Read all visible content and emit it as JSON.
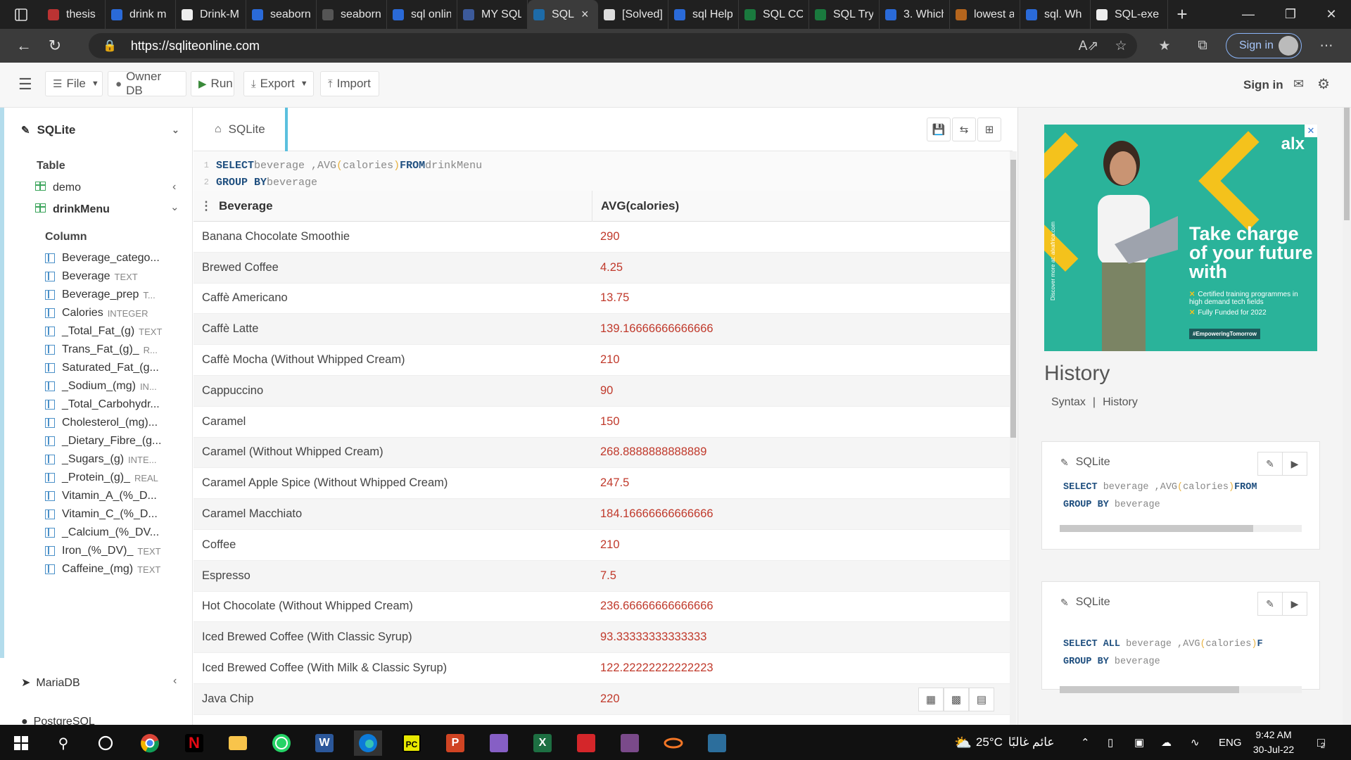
{
  "browser": {
    "tabs": [
      {
        "title": "thesis g",
        "color": "#b33"
      },
      {
        "title": "drink m",
        "color": "#2a6ad8"
      },
      {
        "title": "Drink-M",
        "color": "#eee"
      },
      {
        "title": "seaborn",
        "color": "#2a6ad8"
      },
      {
        "title": "seaborn",
        "color": "#555"
      },
      {
        "title": "sql onlin",
        "color": "#2a6ad8"
      },
      {
        "title": "MY SQL",
        "color": "#3c5a9a"
      },
      {
        "title": "SQL",
        "color": "#1d6ba8",
        "active": true
      },
      {
        "title": "[Solved]",
        "color": "#ddd"
      },
      {
        "title": "sql Help",
        "color": "#2a6ad8"
      },
      {
        "title": "SQL CO",
        "color": "#1a7a3e"
      },
      {
        "title": "SQL Try",
        "color": "#1a7a3e"
      },
      {
        "title": "3. Which",
        "color": "#2a6ad8"
      },
      {
        "title": "lowest a",
        "color": "#b5651d"
      },
      {
        "title": "sql. Wh",
        "color": "#2a6ad8"
      },
      {
        "title": "SQL-exe",
        "color": "#eee"
      }
    ],
    "url": "https://sqliteonline.com",
    "signin": "Sign in"
  },
  "toolbar": {
    "file": "File",
    "owner_db": "Owner DB",
    "run": "Run",
    "export": "Export",
    "import": "Import",
    "signin": "Sign in"
  },
  "sidebar": {
    "db_name": "SQLite",
    "table_heading": "Table",
    "tables": [
      "demo",
      "drinkMenu"
    ],
    "column_heading": "Column",
    "columns": [
      {
        "name": "Beverage_catego...",
        "type": ""
      },
      {
        "name": "Beverage",
        "type": "TEXT"
      },
      {
        "name": "Beverage_prep",
        "type": "T..."
      },
      {
        "name": "Calories",
        "type": "INTEGER"
      },
      {
        "name": "_Total_Fat_(g)",
        "type": "TEXT"
      },
      {
        "name": "Trans_Fat_(g)_",
        "type": "R..."
      },
      {
        "name": "Saturated_Fat_(g...",
        "type": ""
      },
      {
        "name": "_Sodium_(mg)",
        "type": "IN..."
      },
      {
        "name": "_Total_Carbohydr...",
        "type": ""
      },
      {
        "name": "Cholesterol_(mg)...",
        "type": ""
      },
      {
        "name": "_Dietary_Fibre_(g...",
        "type": ""
      },
      {
        "name": "_Sugars_(g)",
        "type": "INTE..."
      },
      {
        "name": "_Protein_(g)_",
        "type": "REAL"
      },
      {
        "name": "Vitamin_A_(%_D...",
        "type": ""
      },
      {
        "name": "Vitamin_C_(%_D...",
        "type": ""
      },
      {
        "name": "_Calcium_(%_DV...",
        "type": ""
      },
      {
        "name": "Iron_(%_DV)_",
        "type": "TEXT"
      },
      {
        "name": "Caffeine_(mg)",
        "type": "TEXT"
      }
    ],
    "other_dbs": [
      "MariaDB",
      "PostgreSQL"
    ]
  },
  "editor": {
    "tab_label": "SQLite",
    "line1": {
      "n": "1",
      "k1": "SELECT",
      "a": " beverage ,AVG",
      "p1": "(",
      "b": "calories",
      "p2": ")",
      "k2": "FROM",
      "c": " drinkMenu"
    },
    "line2": {
      "n": "2",
      "k1": "GROUP BY",
      "a": " beverage"
    }
  },
  "results": {
    "headers": [
      "Beverage",
      "AVG(calories)"
    ],
    "rows": [
      [
        "Banana Chocolate Smoothie",
        "290"
      ],
      [
        "Brewed Coffee",
        "4.25"
      ],
      [
        "Caffè Americano",
        "13.75"
      ],
      [
        "Caffè Latte",
        "139.16666666666666"
      ],
      [
        "Caffè Mocha (Without Whipped Cream)",
        "210"
      ],
      [
        "Cappuccino",
        "90"
      ],
      [
        "Caramel",
        "150"
      ],
      [
        "Caramel (Without Whipped Cream)",
        "268.8888888888889"
      ],
      [
        "Caramel Apple Spice (Without Whipped Cream)",
        "247.5"
      ],
      [
        "Caramel Macchiato",
        "184.16666666666666"
      ],
      [
        "Coffee",
        "210"
      ],
      [
        "Espresso",
        "7.5"
      ],
      [
        "Hot Chocolate (Without Whipped Cream)",
        "236.66666666666666"
      ],
      [
        "Iced Brewed Coffee (With Classic Syrup)",
        "93.33333333333333"
      ],
      [
        "Iced Brewed Coffee (With Milk & Classic Syrup)",
        "122.22222222222223"
      ],
      [
        "Java Chip",
        "220"
      ]
    ]
  },
  "ad": {
    "logo": "alx",
    "headline": "Take charge of your future with",
    "bullet1": "Certified training programmes in high demand tech fields",
    "bullet2": "Fully Funded for 2022",
    "tag": "#EmpoweringTomorrow",
    "side_text": "Discover more at: alxafrica.com"
  },
  "history": {
    "title": "History",
    "link_syntax": "Syntax",
    "separator": "|",
    "link_history": "History",
    "cards": [
      {
        "label": "SQLite",
        "line1_k": "SELECT",
        "line1_a": " beverage ,AVG",
        "line1_p": "(",
        "line1_b": "calories",
        "line1_p2": ")",
        "line1_k2": "FROM",
        "line2_k": "GROUP BY",
        "line2_a": " beverage",
        "progress": 0.8
      },
      {
        "label": "SQLite",
        "line1_k": "SELECT ALL",
        "line1_a": " beverage ,AVG",
        "line1_p": "(",
        "line1_b": "calories",
        "line1_p2": ")",
        "line1_k2": "F",
        "line2_k": "GROUP BY",
        "line2_a": " beverage",
        "progress": 0.74
      }
    ]
  },
  "taskbar": {
    "weather": "25°C",
    "weather_text": "عائم غالبًا",
    "lang": "ENG",
    "time": "9:42 AM",
    "date": "30-Jul-22",
    "notif_count": "2"
  }
}
